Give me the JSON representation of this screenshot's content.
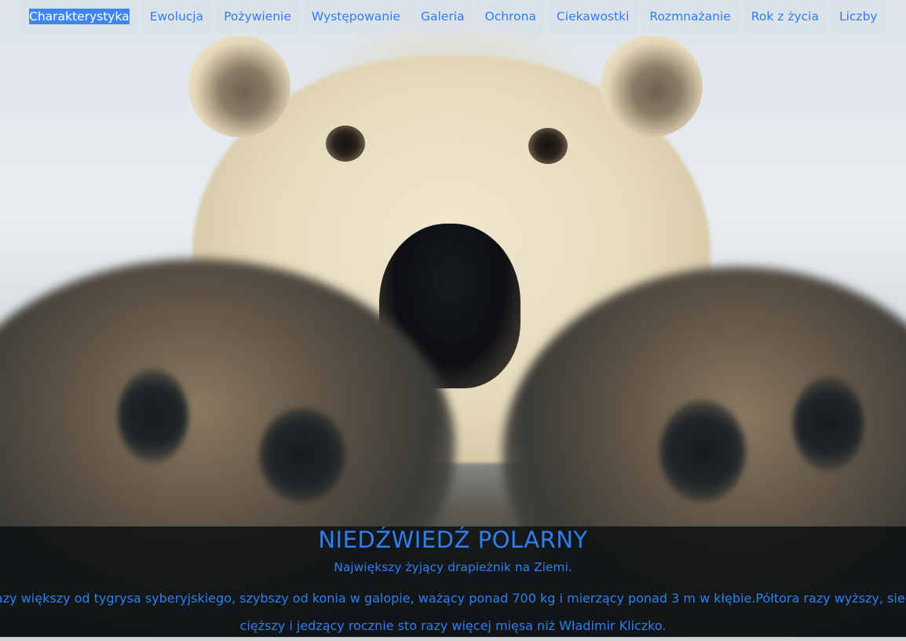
{
  "nav": {
    "items": [
      {
        "label": "Charakterystyka",
        "active": true
      },
      {
        "label": "Ewolucja"
      },
      {
        "label": "Pożywienie"
      },
      {
        "label": "Występowanie"
      },
      {
        "label": "Galeria"
      },
      {
        "label": "Ochrona"
      },
      {
        "label": "Ciekawostki"
      },
      {
        "label": "Rozmnażanie"
      },
      {
        "label": "Rok z życia"
      },
      {
        "label": "Liczby"
      }
    ]
  },
  "hero": {
    "title": "NIEDŹWIEDŹ POLARNY",
    "subtitle": "Największy żyjący drapieżnik na Ziemi.",
    "description_line1": "Półtora razy większy od tygrysa syberyjskiego, szybszy od konia w galopie, ważący ponad 700 kg i mierzący ponad 3 m w kłębie.Półtora razy wyższy, siedem razy",
    "description_line2": "cięższy i jedzący rocznie sto razy więcej mięsa niż Władimir Kliczko."
  },
  "colors": {
    "accent": "#2f7ef0",
    "nav_bg": "#dae1e8",
    "active_highlight": "#3f87ee",
    "caption_bg": "#0c0f12"
  }
}
